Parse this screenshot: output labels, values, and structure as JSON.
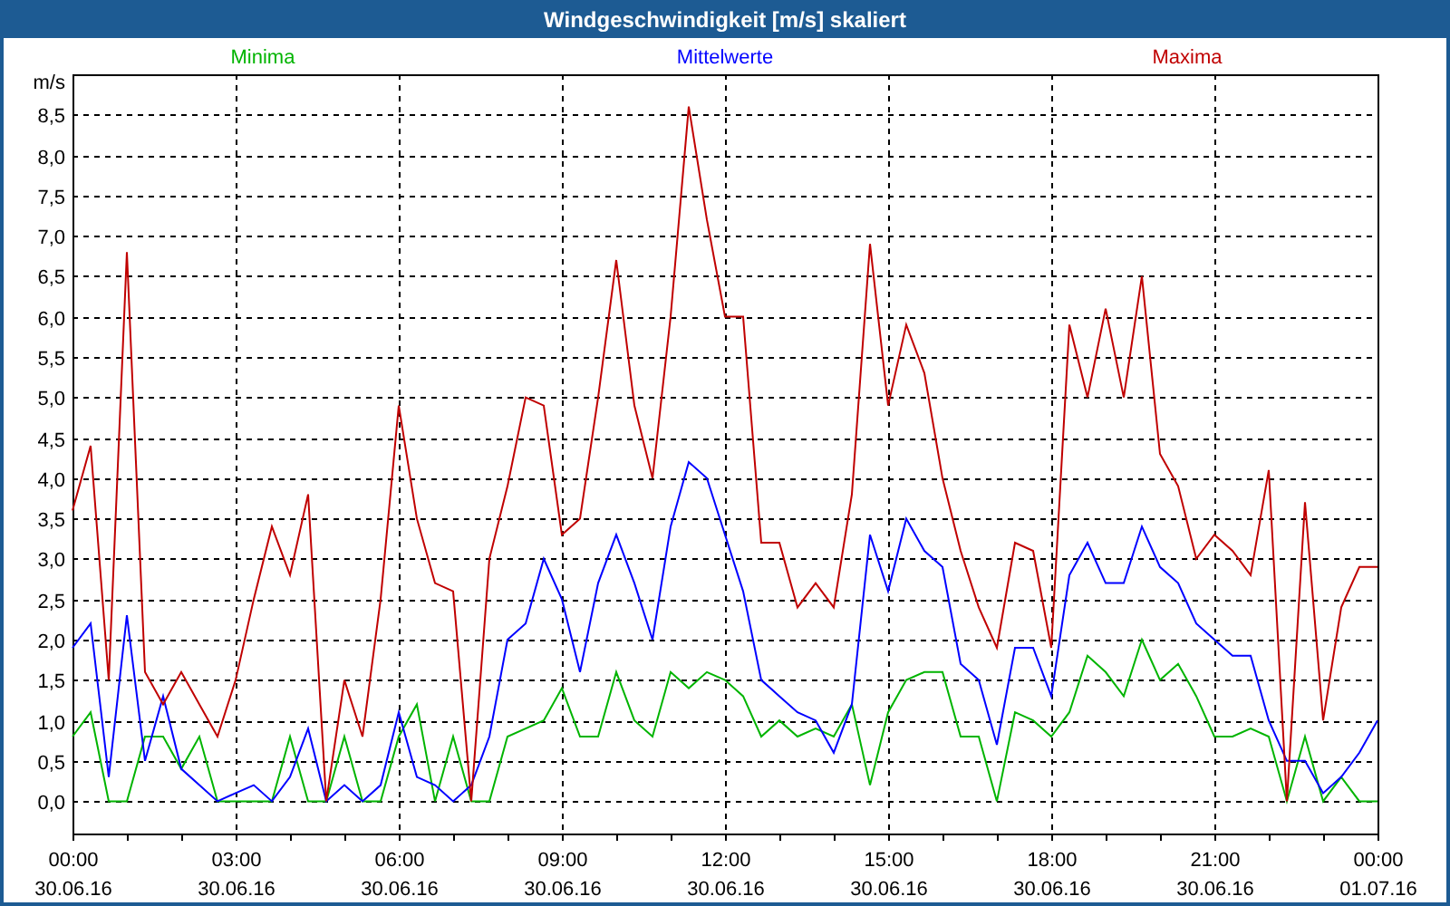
{
  "window": {
    "title": "Windgeschwindigkeit [m/s] skaliert"
  },
  "chart": {
    "chart_data": {
      "type": "line",
      "grid": true,
      "ylabel": "m/s",
      "ylim": [
        -0.4,
        9.0
      ],
      "categories": [
        "00:00\n30.06.16",
        null,
        null,
        null,
        null,
        null,
        null,
        null,
        null,
        "03:00\n30.06.16",
        null,
        null,
        null,
        null,
        null,
        null,
        null,
        null,
        "06:00\n30.06.16",
        null,
        null,
        null,
        null,
        null,
        null,
        null,
        null,
        "09:00\n30.06.16",
        null,
        null,
        null,
        null,
        null,
        null,
        null,
        null,
        "12:00\n30.06.16",
        null,
        null,
        null,
        null,
        null,
        null,
        null,
        null,
        "15:00\n30.06.16",
        null,
        null,
        null,
        null,
        null,
        null,
        null,
        null,
        "18:00\n30.06.16",
        null,
        null,
        null,
        null,
        null,
        null,
        null,
        null,
        "21:00\n30.06.16",
        null,
        null,
        null,
        null,
        null,
        null,
        null,
        null,
        "00:00\n01.07.16"
      ],
      "yticks": [
        {
          "value": 0,
          "label": "0,0"
        },
        {
          "value": 0.5,
          "label": "0,5"
        },
        {
          "value": 1,
          "label": "1,0"
        },
        {
          "value": 1.5,
          "label": "1,5"
        },
        {
          "value": 2,
          "label": "2,0"
        },
        {
          "value": 2.5,
          "label": "2,5"
        },
        {
          "value": 3,
          "label": "3,0"
        },
        {
          "value": 3.5,
          "label": "3,5"
        },
        {
          "value": 4,
          "label": "4,0"
        },
        {
          "value": 4.5,
          "label": "4,5"
        },
        {
          "value": 5,
          "label": "5,0"
        },
        {
          "value": 5.5,
          "label": "5,5"
        },
        {
          "value": 6,
          "label": "6,0"
        },
        {
          "value": 6.5,
          "label": "6,5"
        },
        {
          "value": 7,
          "label": "7,0"
        },
        {
          "value": 7.5,
          "label": "7,5"
        },
        {
          "value": 8,
          "label": "8,0"
        },
        {
          "value": 8.5,
          "label": "8,5"
        }
      ],
      "series": [
        {
          "name": "Minima",
          "color": "#00b400",
          "values": [
            0.8,
            1.1,
            0.0,
            0.0,
            0.8,
            0.8,
            0.4,
            0.8,
            0.0,
            0.0,
            0.0,
            0.0,
            0.8,
            0.0,
            0.0,
            0.8,
            0.0,
            0.0,
            0.8,
            1.2,
            0.0,
            0.8,
            0.0,
            0.0,
            0.8,
            0.9,
            1.0,
            1.4,
            0.8,
            0.8,
            1.6,
            1.0,
            0.8,
            1.6,
            1.4,
            1.6,
            1.5,
            1.3,
            0.8,
            1.0,
            0.8,
            0.9,
            0.8,
            1.2,
            0.2,
            1.1,
            1.5,
            1.6,
            1.6,
            0.8,
            0.8,
            0.0,
            1.1,
            1.0,
            0.8,
            1.1,
            1.8,
            1.6,
            1.3,
            2.0,
            1.5,
            1.7,
            1.3,
            0.8,
            0.8,
            0.9,
            0.8,
            0.0,
            0.8,
            0.0,
            0.3,
            0.0,
            0.0
          ]
        },
        {
          "name": "Mittelwerte",
          "color": "#0000ff",
          "values": [
            1.9,
            2.2,
            0.3,
            2.3,
            0.5,
            1.3,
            0.4,
            0.2,
            0.0,
            0.1,
            0.2,
            0.0,
            0.3,
            0.9,
            0.0,
            0.2,
            0.0,
            0.2,
            1.1,
            0.3,
            0.2,
            0.0,
            0.2,
            0.8,
            2.0,
            2.2,
            3.0,
            2.5,
            1.6,
            2.7,
            3.3,
            2.7,
            2.0,
            3.4,
            4.2,
            4.0,
            3.3,
            2.6,
            1.5,
            1.3,
            1.1,
            1.0,
            0.6,
            1.2,
            3.3,
            2.6,
            3.5,
            3.1,
            2.9,
            1.7,
            1.5,
            0.7,
            1.9,
            1.9,
            1.3,
            2.8,
            3.2,
            2.7,
            2.7,
            3.4,
            2.9,
            2.7,
            2.2,
            2.0,
            1.8,
            1.8,
            1.0,
            0.5,
            0.5,
            0.1,
            0.3,
            0.6,
            1.0
          ]
        },
        {
          "name": "Maxima",
          "color": "#c00000",
          "values": [
            3.6,
            4.4,
            1.5,
            6.8,
            1.6,
            1.2,
            1.6,
            1.2,
            0.8,
            1.5,
            2.5,
            3.4,
            2.8,
            3.8,
            0.0,
            1.5,
            0.8,
            2.5,
            4.9,
            3.5,
            2.7,
            2.6,
            0.0,
            3.0,
            3.9,
            5.0,
            4.9,
            3.3,
            3.5,
            5.0,
            6.7,
            4.9,
            4.0,
            6.0,
            8.6,
            7.2,
            6.0,
            6.0,
            3.2,
            3.2,
            2.4,
            2.7,
            2.4,
            3.8,
            6.9,
            4.9,
            5.9,
            5.3,
            4.0,
            3.1,
            2.4,
            1.9,
            3.2,
            3.1,
            1.9,
            5.9,
            5.0,
            6.1,
            5.0,
            6.5,
            4.3,
            3.9,
            3.0,
            3.3,
            3.1,
            2.8,
            4.1,
            0.0,
            3.7,
            1.0,
            2.4,
            2.9,
            2.9
          ]
        }
      ]
    }
  }
}
